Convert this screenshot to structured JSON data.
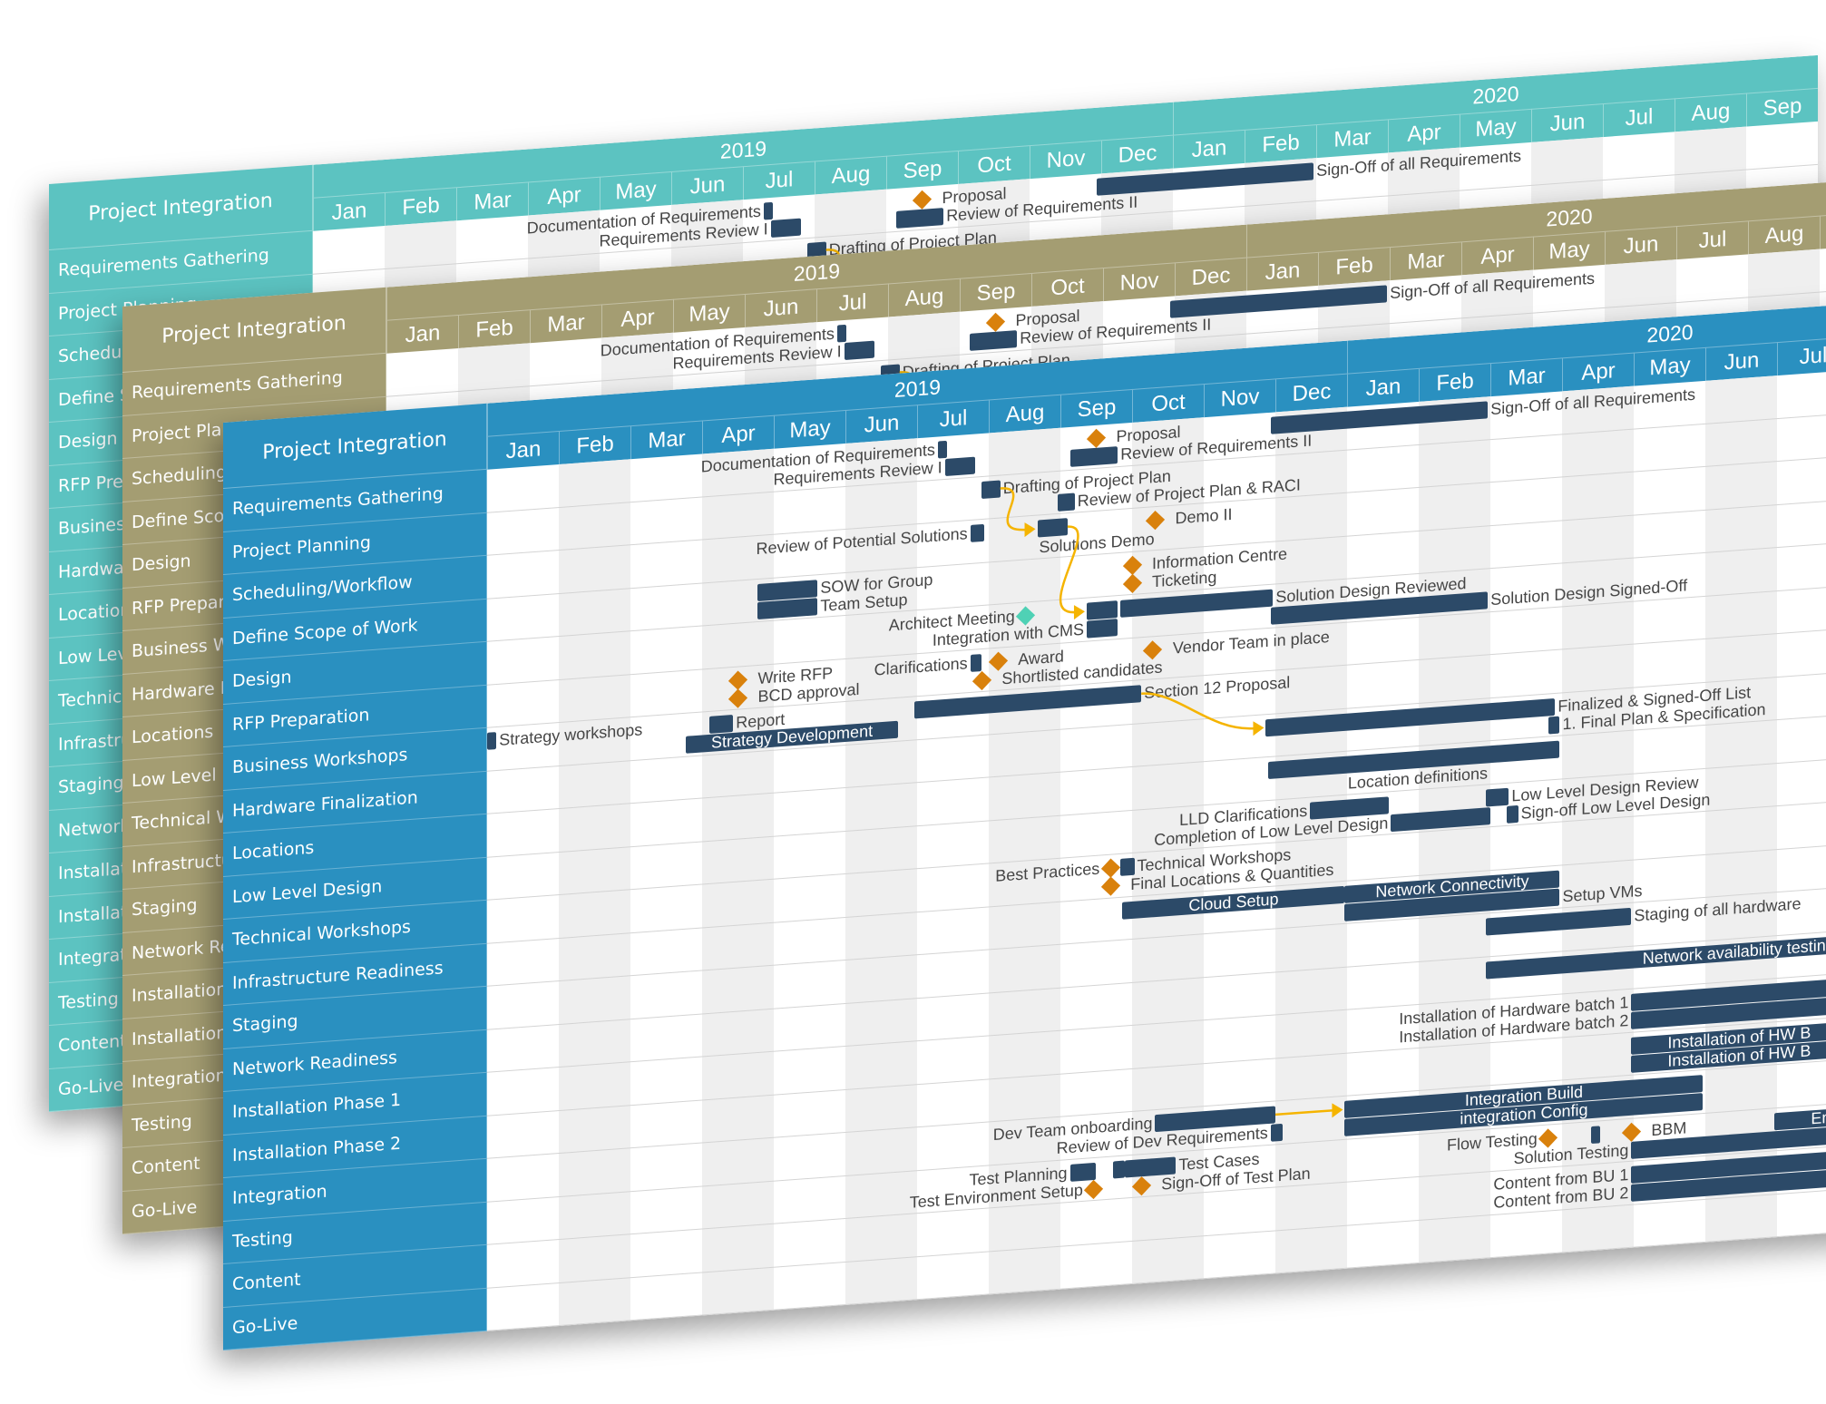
{
  "panels": [
    {
      "theme": "teal",
      "header_color": "#5cc3c1"
    },
    {
      "theme": "tan",
      "header_color": "#a49d72"
    },
    {
      "theme": "blue",
      "header_color": "#2a90c0"
    }
  ],
  "colors": {
    "bar": "#2c4a68",
    "milestone": "#d9810c",
    "milestone_alt": "#4fd1b5",
    "dependency": "#f5b400",
    "stripe": "#efefef"
  },
  "chart_data": {
    "type": "bar",
    "variant": "gantt",
    "title": "Project Integration",
    "timeline": {
      "start": "2019-01",
      "end": "2020-09",
      "years": [
        {
          "label": "2019",
          "months": [
            "Jan",
            "Feb",
            "Mar",
            "Apr",
            "May",
            "Jun",
            "Jul",
            "Aug",
            "Sep",
            "Oct",
            "Nov",
            "Dec"
          ]
        },
        {
          "label": "2020",
          "months": [
            "Jan",
            "Feb",
            "Mar",
            "Apr",
            "May",
            "Jun",
            "Jul",
            "Aug",
            "Sep"
          ]
        }
      ]
    },
    "rows": [
      "Requirements Gathering",
      "Project Planning",
      "Scheduling/Workflow",
      "Define Scope of Work",
      "Design",
      "RFP Preparation",
      "Business Workshops",
      "Hardware Finalization",
      "Locations",
      "Low Level Design",
      "Technical Workshops",
      "Infrastructure Readiness",
      "Staging",
      "Network Readiness",
      "Installation Phase 1",
      "Installation Phase 2",
      "Integration",
      "Testing",
      "Content",
      "Go-Live"
    ],
    "grid": true,
    "tasks": [
      {
        "id": "t1",
        "row": 0,
        "lane": 0,
        "type": "bar",
        "start": "2019-07-10",
        "end": "2019-07-13",
        "label": "Documentation of Requirements",
        "label_pos": "left"
      },
      {
        "id": "t2",
        "row": 0,
        "lane": 1,
        "type": "bar",
        "start": "2019-07-13",
        "end": "2019-07-25",
        "label": "Requirements Review I",
        "label_pos": "left"
      },
      {
        "id": "t3",
        "row": 0,
        "lane": 0,
        "type": "milestone",
        "start": "2019-09-16",
        "label": "Proposal",
        "label_pos": "right"
      },
      {
        "id": "t4",
        "row": 0,
        "lane": 1,
        "type": "bar",
        "start": "2019-09-05",
        "end": "2019-09-24",
        "label": "Review of Requirements II",
        "label_pos": "right"
      },
      {
        "id": "t5",
        "row": 0,
        "lane": 0,
        "type": "bar",
        "start": "2019-11-29",
        "end": "2020-02-28",
        "label": "Sign-Off of all Requirements",
        "label_pos": "right"
      },
      {
        "id": "t6",
        "row": 1,
        "lane": 0,
        "type": "bar",
        "start": "2019-07-29",
        "end": "2019-08-05",
        "label": "Drafting of Project Plan",
        "label_pos": "right"
      },
      {
        "id": "t7",
        "row": 1,
        "lane": 1,
        "type": "bar",
        "start": "2019-08-31",
        "end": "2019-09-06",
        "label": "Review of Project Plan & RACI",
        "label_pos": "right"
      },
      {
        "id": "t8",
        "row": 2,
        "lane": 0,
        "type": "bar",
        "start": "2019-07-24",
        "end": "2019-07-29",
        "label": "Review of Potential Solutions",
        "label_pos": "left"
      },
      {
        "id": "t9",
        "row": 2,
        "lane": 0,
        "type": "bar",
        "start": "2019-08-22",
        "end": "2019-09-03",
        "label": "Solutions Demo",
        "label_pos": "below"
      },
      {
        "id": "t10",
        "row": 2,
        "lane": 0,
        "type": "milestone",
        "start": "2019-10-11",
        "label": "Demo II",
        "label_pos": "right"
      },
      {
        "id": "t11",
        "row": 3,
        "lane": 0,
        "type": "milestone",
        "start": "2019-10-01",
        "label": "Information Centre",
        "label_pos": "right"
      },
      {
        "id": "t12",
        "row": 3,
        "lane": 1,
        "type": "milestone",
        "start": "2019-10-01",
        "label": "Ticketing",
        "label_pos": "right"
      },
      {
        "id": "t13",
        "row": 3,
        "lane": 0,
        "type": "bar",
        "start": "2019-04-24",
        "end": "2019-05-19",
        "label": "SOW for Group",
        "label_pos": "right"
      },
      {
        "id": "t14",
        "row": 3,
        "lane": 1,
        "type": "bar",
        "start": "2019-04-24",
        "end": "2019-05-19",
        "label": "Team Setup",
        "label_pos": "right"
      },
      {
        "id": "t15",
        "row": 4,
        "lane": 0,
        "type": "milestone",
        "start": "2019-08-17",
        "label": "Architect Meeting",
        "label_pos": "left",
        "alt": true
      },
      {
        "id": "t16",
        "row": 4,
        "lane": 0,
        "type": "bar",
        "start": "2019-09-12",
        "end": "2019-09-24",
        "label": "",
        "label_pos": "none"
      },
      {
        "id": "t17",
        "row": 4,
        "lane": 1,
        "type": "bar",
        "start": "2019-09-12",
        "end": "2019-09-24",
        "label": "Integration with CMS",
        "label_pos": "left"
      },
      {
        "id": "t18",
        "row": 4,
        "lane": 0,
        "type": "bar",
        "start": "2019-09-26",
        "end": "2019-11-29",
        "label": "Solution Design Reviewed",
        "label_pos": "right"
      },
      {
        "id": "t19",
        "row": 4,
        "lane": 1,
        "type": "bar",
        "start": "2019-11-29",
        "end": "2020-02-28",
        "label": "Solution Design Signed-Off",
        "label_pos": "right"
      },
      {
        "id": "t20",
        "row": 5,
        "lane": 0,
        "type": "milestone",
        "start": "2019-04-16",
        "label": "Write RFP",
        "label_pos": "right"
      },
      {
        "id": "t21",
        "row": 5,
        "lane": 1,
        "type": "milestone",
        "start": "2019-04-16",
        "label": "BCD approval",
        "label_pos": "right"
      },
      {
        "id": "t22",
        "row": 5,
        "lane": 0,
        "type": "bar",
        "start": "2019-07-24",
        "end": "2019-07-28",
        "label": "Clarifications",
        "label_pos": "left"
      },
      {
        "id": "t23",
        "row": 5,
        "lane": 0,
        "type": "milestone",
        "start": "2019-08-05",
        "label": "Award",
        "label_pos": "right"
      },
      {
        "id": "t24",
        "row": 5,
        "lane": 1,
        "type": "milestone",
        "start": "2019-07-29",
        "label": "Shortlisted candidates",
        "label_pos": "right"
      },
      {
        "id": "t25",
        "row": 5,
        "lane": 0,
        "type": "milestone",
        "start": "2019-10-10",
        "label": "Vendor Team in place",
        "label_pos": "right"
      },
      {
        "id": "t26",
        "row": 6,
        "lane": 0,
        "type": "bar",
        "start": "2019-01-01",
        "end": "2019-01-04",
        "label": "Strategy workshops",
        "label_pos": "right"
      },
      {
        "id": "t27",
        "row": 6,
        "lane": 0,
        "type": "bar",
        "start": "2019-04-04",
        "end": "2019-04-13",
        "label": "Report",
        "label_pos": "right"
      },
      {
        "id": "t28",
        "row": 6,
        "lane": 1,
        "type": "bar",
        "start": "2019-03-25",
        "end": "2019-06-22",
        "label": "Strategy Development",
        "label_pos": "inside"
      },
      {
        "id": "t29",
        "row": 6,
        "lane": 0,
        "type": "bar",
        "start": "2019-06-30",
        "end": "2019-10-04",
        "label": "Section 12 Proposal",
        "label_pos": "right"
      },
      {
        "id": "t30",
        "row": 7,
        "lane": 0,
        "type": "bar",
        "start": "2019-11-27",
        "end": "2020-03-28",
        "label": "Finalized & Signed-Off List",
        "label_pos": "right"
      },
      {
        "id": "t31",
        "row": 7,
        "lane": 1,
        "type": "bar",
        "start": "2020-03-26",
        "end": "2020-03-30",
        "label": "1. Final Plan  & Specification",
        "label_pos": "right"
      },
      {
        "id": "t32",
        "row": 8,
        "lane": 0,
        "type": "bar",
        "start": "2019-11-28",
        "end": "2020-03-01",
        "label": "",
        "label_pos": "none"
      },
      {
        "id": "t33",
        "row": 8,
        "lane": 0,
        "type": "bar",
        "start": "2020-03-01",
        "end": "2020-03-30",
        "label": "Location definitions",
        "label_pos": "below-left"
      },
      {
        "id": "t34",
        "row": 9,
        "lane": 0,
        "type": "bar",
        "start": "2019-12-16",
        "end": "2020-01-18",
        "label": "LLD Clarifications",
        "label_pos": "left"
      },
      {
        "id": "t35",
        "row": 9,
        "lane": 1,
        "type": "bar",
        "start": "2020-01-20",
        "end": "2020-02-29",
        "label": "Completion of Low Level Design",
        "label_pos": "left"
      },
      {
        "id": "t36",
        "row": 9,
        "lane": 0,
        "type": "bar",
        "start": "2020-02-28",
        "end": "2020-03-08",
        "label": "Low Level Design Review",
        "label_pos": "right"
      },
      {
        "id": "t37",
        "row": 9,
        "lane": 1,
        "type": "bar",
        "start": "2020-03-08",
        "end": "2020-03-12",
        "label": "Sign-off Low Level Design",
        "label_pos": "right"
      },
      {
        "id": "t38",
        "row": 10,
        "lane": 0,
        "type": "milestone",
        "start": "2019-09-22",
        "label": "Best Practices",
        "label_pos": "left"
      },
      {
        "id": "t39",
        "row": 10,
        "lane": 0,
        "type": "bar",
        "start": "2019-09-26",
        "end": "2019-10-01",
        "label": "Technical Workshops",
        "label_pos": "right"
      },
      {
        "id": "t40",
        "row": 10,
        "lane": 1,
        "type": "milestone",
        "start": "2019-09-22",
        "label": "Final Locations & Quantities",
        "label_pos": "right"
      },
      {
        "id": "t41",
        "row": 11,
        "lane": 0,
        "type": "bar",
        "start": "2019-09-27",
        "end": "2019-12-30",
        "label": "Cloud Setup",
        "label_pos": "inside"
      },
      {
        "id": "t42",
        "row": 11,
        "lane": 0,
        "type": "bar",
        "start": "2019-12-31",
        "end": "2020-03-30",
        "label": "Network Connectivity",
        "label_pos": "inside"
      },
      {
        "id": "t43",
        "row": 11,
        "lane": 1,
        "type": "bar",
        "start": "2019-12-31",
        "end": "2020-03-30",
        "label": "Setup VMs",
        "label_pos": "right"
      },
      {
        "id": "t44",
        "row": 12,
        "lane": 0,
        "type": "bar",
        "start": "2020-02-28",
        "end": "2020-04-29",
        "label": "Staging of all hardware",
        "label_pos": "right"
      },
      {
        "id": "t45",
        "row": 13,
        "lane": 0,
        "type": "bar",
        "start": "2020-02-28",
        "end": "2020-09-30",
        "label": "Network availability testing",
        "label_pos": "inside"
      },
      {
        "id": "t46",
        "row": 14,
        "lane": 0,
        "type": "bar",
        "start": "2020-04-30",
        "end": "2020-09-30",
        "label": "Installation of Hardware batch 1",
        "label_pos": "left"
      },
      {
        "id": "t47",
        "row": 14,
        "lane": 1,
        "type": "bar",
        "start": "2020-04-30",
        "end": "2020-09-30",
        "label": "Installation of Hardware batch 2",
        "label_pos": "left"
      },
      {
        "id": "t48",
        "row": 15,
        "lane": 0,
        "type": "bar",
        "start": "2020-04-30",
        "end": "2020-09-30",
        "label": "Installation of HW B",
        "label_pos": "inside-start"
      },
      {
        "id": "t49",
        "row": 15,
        "lane": 1,
        "type": "bar",
        "start": "2020-04-30",
        "end": "2020-09-30",
        "label": "Installation of HW B",
        "label_pos": "inside-start"
      },
      {
        "id": "t50",
        "row": 16,
        "lane": 0,
        "type": "bar",
        "start": "2019-10-11",
        "end": "2019-11-30",
        "label": "Dev Team onboarding",
        "label_pos": "left"
      },
      {
        "id": "t51",
        "row": 16,
        "lane": 1,
        "type": "bar",
        "start": "2019-11-29",
        "end": "2019-12-03",
        "label": "Review of Dev Requirements",
        "label_pos": "left"
      },
      {
        "id": "t52",
        "row": 16,
        "lane": 0,
        "type": "bar",
        "start": "2019-12-31",
        "end": "2020-05-30",
        "label": "Integration Build",
        "label_pos": "inside"
      },
      {
        "id": "t53",
        "row": 16,
        "lane": 1,
        "type": "bar",
        "start": "2019-12-31",
        "end": "2020-05-30",
        "label": "integration Config",
        "label_pos": "inside"
      },
      {
        "id": "t54",
        "row": 17,
        "lane": 0,
        "type": "bar",
        "start": "2019-09-05",
        "end": "2019-09-15",
        "label": "Test Planning",
        "label_pos": "left"
      },
      {
        "id": "t55",
        "row": 17,
        "lane": 0,
        "type": "bar",
        "start": "2019-09-23",
        "end": "2019-09-27",
        "label": "",
        "label_pos": "none"
      },
      {
        "id": "t56",
        "row": 17,
        "lane": 0,
        "type": "bar",
        "start": "2019-09-28",
        "end": "2019-10-05",
        "label": "",
        "label_pos": "none"
      },
      {
        "id": "t57",
        "row": 17,
        "lane": 0,
        "type": "bar",
        "start": "2019-10-05",
        "end": "2019-10-19",
        "label": "Test Cases",
        "label_pos": "right"
      },
      {
        "id": "t58",
        "row": 17,
        "lane": 1,
        "type": "milestone",
        "start": "2019-09-15",
        "label": "Test Environment Setup",
        "label_pos": "left"
      },
      {
        "id": "t59",
        "row": 17,
        "lane": 1,
        "type": "milestone",
        "start": "2019-10-05",
        "label": "Sign-Off of Test Plan",
        "label_pos": "right"
      },
      {
        "id": "t60",
        "row": 17,
        "lane": 0,
        "type": "milestone",
        "start": "2020-03-26",
        "label": "Flow Testing",
        "label_pos": "left"
      },
      {
        "id": "t61",
        "row": 17,
        "lane": 0,
        "type": "bar",
        "start": "2020-04-13",
        "end": "2020-04-16",
        "label": "",
        "label_pos": "none"
      },
      {
        "id": "t62",
        "row": 17,
        "lane": 0,
        "type": "milestone",
        "start": "2020-04-30",
        "label": "BBM",
        "label_pos": "right"
      },
      {
        "id": "t63",
        "row": 17,
        "lane": 1,
        "type": "bar",
        "start": "2020-04-30",
        "end": "2020-09-30",
        "label": "Solution Testing",
        "label_pos": "left"
      },
      {
        "id": "t64",
        "row": 17,
        "lane": 0,
        "type": "bar",
        "start": "2020-06-30",
        "end": "2020-09-30",
        "label": "End",
        "label_pos": "inside-start"
      },
      {
        "id": "t65",
        "row": 18,
        "lane": 0,
        "type": "bar",
        "start": "2020-04-30",
        "end": "2020-09-30",
        "label": "Content from BU 1",
        "label_pos": "left"
      },
      {
        "id": "t66",
        "row": 18,
        "lane": 1,
        "type": "bar",
        "start": "2020-04-30",
        "end": "2020-09-30",
        "label": "Content from BU 2",
        "label_pos": "left"
      }
    ],
    "dependencies": [
      [
        "t6",
        "t9"
      ],
      [
        "t9",
        "t16"
      ],
      [
        "t29",
        "t30"
      ],
      [
        "t50",
        "t52"
      ]
    ]
  }
}
